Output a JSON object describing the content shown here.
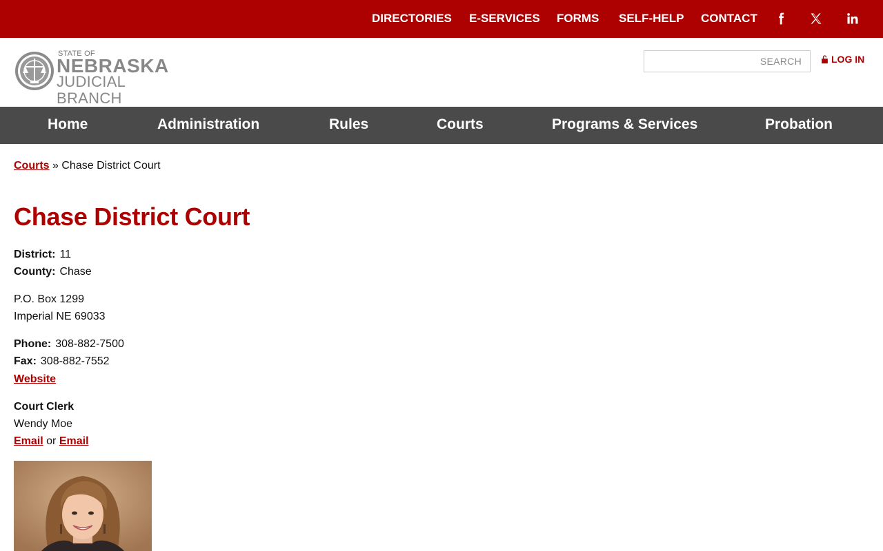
{
  "topnav": {
    "items": [
      "DIRECTORIES",
      "E-SERVICES",
      "FORMS",
      "SELF-HELP",
      "CONTACT"
    ],
    "social": [
      "facebook-icon",
      "x-twitter-icon",
      "linkedin-icon"
    ]
  },
  "header": {
    "logo": {
      "state_of": "STATE OF",
      "nebraska": "NEBRASKA",
      "judicial_branch": "JUDICIAL BRANCH"
    },
    "search_placeholder": "SEARCH",
    "login_label": "LOG IN"
  },
  "mainnav": {
    "items": [
      "Home",
      "Administration",
      "Rules",
      "Courts",
      "Programs & Services",
      "Probation"
    ]
  },
  "breadcrumb": {
    "link": "Courts",
    "separator": "»",
    "current": "Chase District Court"
  },
  "page": {
    "title": "Chase District Court",
    "district_label": "District:",
    "district_value": "11",
    "county_label": "County:",
    "county_value": "Chase",
    "address_line1": "P.O. Box 1299",
    "address_line2": "Imperial NE 69033",
    "phone_label": "Phone:",
    "phone_value": "308-882-7500",
    "fax_label": "Fax:",
    "fax_value": "308-882-7552",
    "website_link": "Website",
    "clerk_heading": "Court Clerk",
    "clerk_name": "Wendy Moe",
    "email1": "Email",
    "or_text": "or",
    "email2": "Email"
  },
  "colors": {
    "brand_red": "#ad0000",
    "nav_gray": "#4a4a4a"
  }
}
